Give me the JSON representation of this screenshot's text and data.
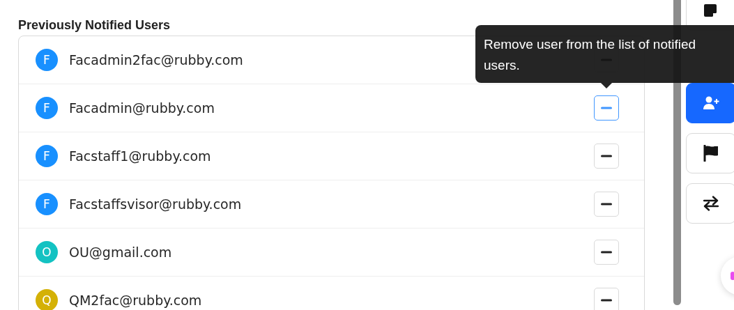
{
  "heading": "Previously Notified Users",
  "users": [
    {
      "initial": "F",
      "email": "Facadmin2fac@rubby.com",
      "color": "#1890ff",
      "focused": false
    },
    {
      "initial": "F",
      "email": "Facadmin@rubby.com",
      "color": "#1890ff",
      "focused": true
    },
    {
      "initial": "F",
      "email": "Facstaff1@rubby.com",
      "color": "#1890ff",
      "focused": false
    },
    {
      "initial": "F",
      "email": "Facstaffsvisor@rubby.com",
      "color": "#1890ff",
      "focused": false
    },
    {
      "initial": "O",
      "email": "OU@gmail.com",
      "color": "#13c2c2",
      "focused": false
    },
    {
      "initial": "Q",
      "email": "QM2fac@rubby.com",
      "color": "#d4b106",
      "focused": false
    }
  ],
  "tooltip": "Remove user from the list of notified users.",
  "tools": [
    {
      "kind": "note",
      "selected": false
    },
    {
      "kind": "add-user",
      "selected": true
    },
    {
      "kind": "flag",
      "selected": false
    },
    {
      "kind": "swap",
      "selected": false
    }
  ]
}
